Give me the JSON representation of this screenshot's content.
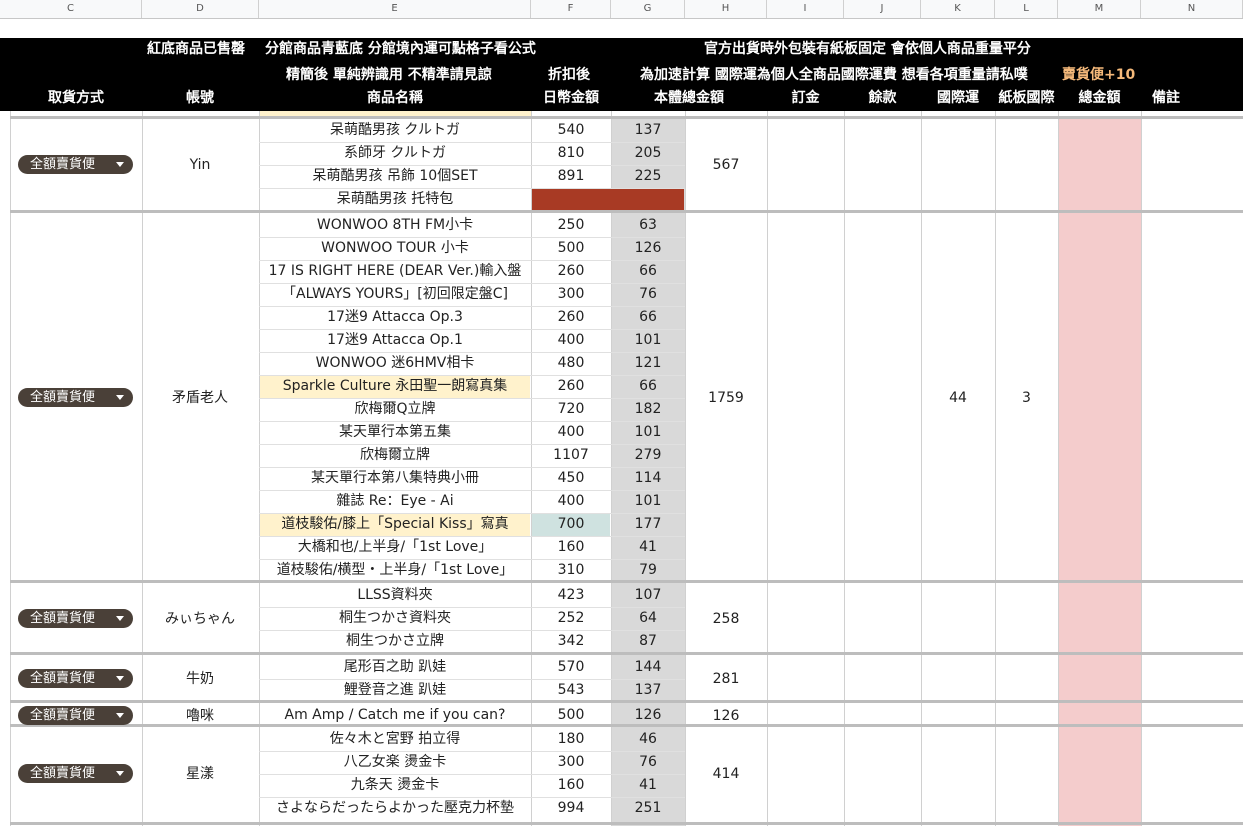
{
  "column_letters": [
    "C",
    "D",
    "E",
    "F",
    "G",
    "H",
    "I",
    "J",
    "K",
    "L",
    "M",
    "N"
  ],
  "header": {
    "row1_note_a": "紅底商品已售罄",
    "row1_note_b": "分館商品青藍底 分館境內運可點格子看公式",
    "row1_note_c": "官方出貨時外包裝有紙板固定 會依個人商品重量平分",
    "row2_note_name": "精簡後 單純辨識用 不精準請見諒",
    "row2_discount": "折扣後",
    "row2_note_intl": "為加速計算 國際運為個人全商品國際運費 想看各項重量請私噗",
    "row2_cod_fee": "賣貨便+10",
    "col_pickup": "取貨方式",
    "col_account": "帳號",
    "col_product": "商品名稱",
    "col_jpy": "日幣金額",
    "col_base_total": "本體總金額",
    "col_deposit": "訂金",
    "col_balance": "餘款",
    "col_intl": "國際運",
    "col_board": "紙板國際",
    "col_total": "總金額",
    "col_note": "備註"
  },
  "pickup_label": "全額賣貨便",
  "colors": {
    "soldout": "#a83a24",
    "branch_blue": "#cfe2e0",
    "highlight_yellow": "#fff2cc",
    "price_col_gray": "#d9d9d9",
    "total_col_pink": "#f4cccc",
    "chip_bg": "#4a4038",
    "cod_fee_orange": "#f5b97a"
  },
  "groups": [
    {
      "account": "Yin",
      "total": "567",
      "intl": "",
      "board": "",
      "items": [
        {
          "name": "呆萌酷男孩 クルトガ",
          "jpy": "540",
          "twd": "137"
        },
        {
          "name": "系師牙 クルトガ",
          "jpy": "810",
          "twd": "205"
        },
        {
          "name": "呆萌酷男孩 吊飾 10個SET",
          "jpy": "891",
          "twd": "225"
        },
        {
          "name": "呆萌酷男孩 托特包",
          "jpy": "",
          "twd": "",
          "soldout": true
        }
      ]
    },
    {
      "account": "矛盾老人",
      "total": "1759",
      "intl": "44",
      "board": "3",
      "items": [
        {
          "name": "WONWOO 8TH FM小卡",
          "jpy": "250",
          "twd": "63"
        },
        {
          "name": "WONWOO TOUR 小卡",
          "jpy": "500",
          "twd": "126"
        },
        {
          "name": "17 IS RIGHT HERE (DEAR Ver.)輸入盤",
          "jpy": "260",
          "twd": "66"
        },
        {
          "name": "「ALWAYS YOURS」[初回限定盤C]",
          "jpy": "300",
          "twd": "76"
        },
        {
          "name": "17迷9 Attacca Op.3",
          "jpy": "260",
          "twd": "66"
        },
        {
          "name": "17迷9 Attacca Op.1",
          "jpy": "400",
          "twd": "101"
        },
        {
          "name": "WONWOO 迷6HMV相卡",
          "jpy": "480",
          "twd": "121"
        },
        {
          "name": "Sparkle Culture 永田聖一朗寫真集",
          "jpy": "260",
          "twd": "66",
          "highlight": true
        },
        {
          "name": "欣梅爾Q立牌",
          "jpy": "720",
          "twd": "182"
        },
        {
          "name": "某天單行本第五集",
          "jpy": "400",
          "twd": "101"
        },
        {
          "name": "欣梅爾立牌",
          "jpy": "1107",
          "twd": "279"
        },
        {
          "name": "某天單行本第八集特典小冊",
          "jpy": "450",
          "twd": "114"
        },
        {
          "name": "雜誌 Re：Eye - Ai",
          "jpy": "400",
          "twd": "101"
        },
        {
          "name": "道枝駿佑/膝上「Special Kiss」寫真",
          "jpy": "700",
          "twd": "177",
          "highlight": true,
          "branch": true
        },
        {
          "name": "大橋和也/上半身/「1st Love」",
          "jpy": "160",
          "twd": "41"
        },
        {
          "name": "道枝駿佑/横型・上半身/「1st Love」",
          "jpy": "310",
          "twd": "79"
        }
      ]
    },
    {
      "account": "みぃちゃん",
      "total": "258",
      "intl": "",
      "board": "",
      "items": [
        {
          "name": "LLSS資料夾",
          "jpy": "423",
          "twd": "107"
        },
        {
          "name": "桐生つかさ資料夾",
          "jpy": "252",
          "twd": "64"
        },
        {
          "name": "桐生つかさ立牌",
          "jpy": "342",
          "twd": "87"
        }
      ]
    },
    {
      "account": "牛奶",
      "total": "281",
      "intl": "",
      "board": "",
      "items": [
        {
          "name": "尾形百之助 趴娃",
          "jpy": "570",
          "twd": "144"
        },
        {
          "name": "鯉登音之進 趴娃",
          "jpy": "543",
          "twd": "137"
        }
      ]
    },
    {
      "account": "嚕咪",
      "total": "126",
      "intl": "",
      "board": "",
      "items": [
        {
          "name": "Am Amp / Catch me if you can?",
          "jpy": "500",
          "twd": "126"
        }
      ]
    },
    {
      "account": "星漾",
      "total": "414",
      "intl": "",
      "board": "",
      "items": [
        {
          "name": "佐々木と宮野 拍立得",
          "jpy": "180",
          "twd": "46"
        },
        {
          "name": "八乙女楽 燙金卡",
          "jpy": "300",
          "twd": "76"
        },
        {
          "name": "九条天 燙金卡",
          "jpy": "160",
          "twd": "41"
        },
        {
          "name": "さよならだったらよかった壓克力杯墊",
          "jpy": "994",
          "twd": "251"
        }
      ]
    }
  ]
}
